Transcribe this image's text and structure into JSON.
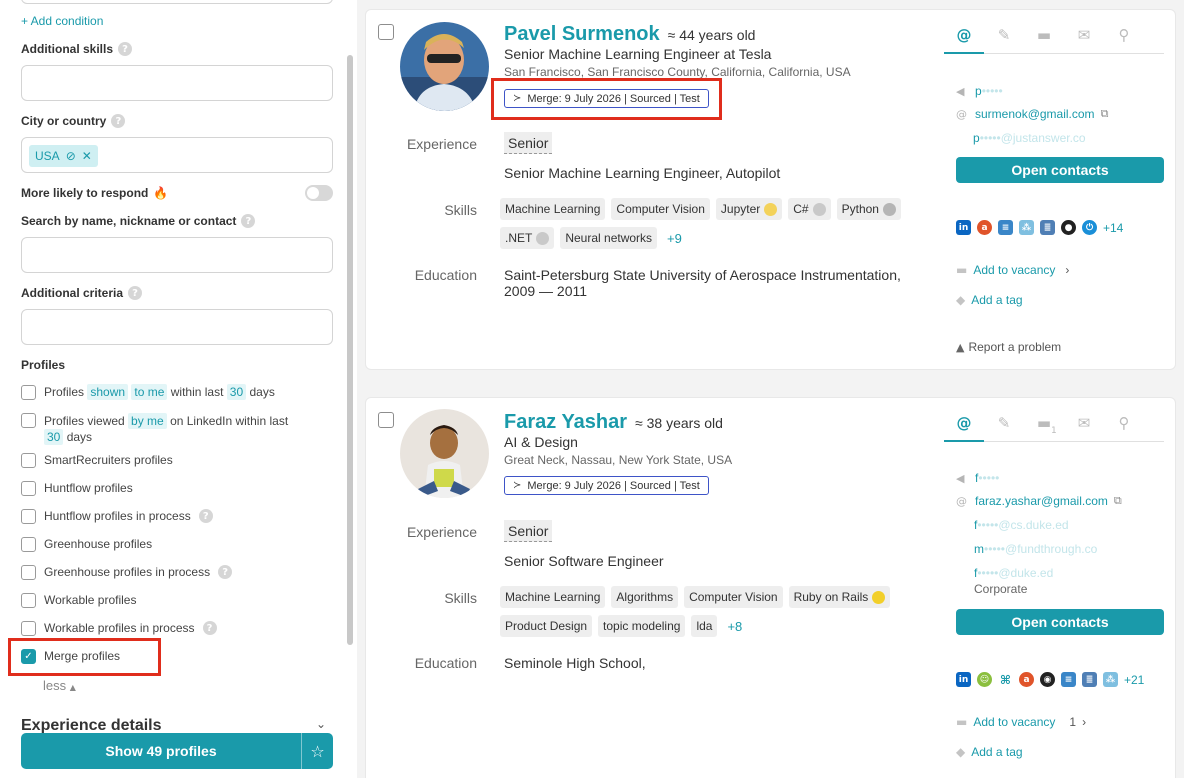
{
  "sidebar": {
    "add_condition": "+ Add condition",
    "additional_skills": {
      "label": "Additional skills",
      "value": ""
    },
    "city": {
      "label": "City or country",
      "chip": "USA"
    },
    "more_likely": {
      "label": "More likely to respond",
      "emoji": "🔥",
      "enabled": false
    },
    "search_name": {
      "label": "Search by name, nickname or contact",
      "value": ""
    },
    "additional_criteria": {
      "label": "Additional criteria",
      "value": ""
    },
    "profiles_heading": "Profiles",
    "profiles": [
      {
        "parts": [
          "Profiles",
          "shown",
          "to me",
          "within last",
          "30",
          "days"
        ]
      },
      {
        "parts": [
          "Profiles viewed",
          "by me",
          "on LinkedIn within last",
          "30",
          "days"
        ]
      },
      {
        "label": "SmartRecruiters profiles",
        "checked": false
      },
      {
        "label": "Huntflow profiles",
        "checked": false
      },
      {
        "label": "Huntflow profiles in process",
        "checked": false
      },
      {
        "label": "Greenhouse profiles",
        "checked": false
      },
      {
        "label": "Greenhouse profiles in process",
        "checked": false
      },
      {
        "label": "Workable profiles",
        "checked": false
      },
      {
        "label": "Workable profiles in process",
        "checked": false
      },
      {
        "label": "Merge profiles",
        "checked": true
      }
    ],
    "less": "less",
    "experience_details": "Experience details",
    "show_button": "Show 49 profiles"
  },
  "cards": [
    {
      "name": "Pavel Surmenok",
      "age": "≈ 44 years old",
      "title": "Senior Machine Learning Engineer at Tesla",
      "location": "San Francisco, San Francisco County, California, California, USA",
      "merge_badge": "Merge: 9 July 2026 | Sourced | Test",
      "labels": {
        "experience": "Experience",
        "skills": "Skills",
        "education": "Education"
      },
      "seniority": "Senior",
      "experience": "Senior Machine Learning Engineer, Autopilot",
      "skills": [
        "Machine Learning",
        "Computer Vision",
        "Jupyter",
        "C#",
        "Python",
        ".NET",
        "Neural networks"
      ],
      "skills_more": "+9",
      "education": "Saint-Petersburg State University of Aerospace Instrumentation, 2009 — 2011",
      "contacts": [
        {
          "icon": "telegram-icon",
          "prefix": "p",
          "mask": "•••••",
          "suffix": ""
        },
        {
          "icon": "at-icon",
          "text": "surmenok@gmail.com"
        },
        {
          "prefix": "p",
          "mask": "•••••",
          "suffix": "@justanswer.co"
        }
      ],
      "open_contacts": "Open contacts",
      "social_more": "+14",
      "add_vacancy": "Add to vacancy",
      "add_tag": "Add a tag",
      "report": "Report a problem"
    },
    {
      "name": "Faraz Yashar",
      "age": "≈ 38 years old",
      "title": "AI & Design",
      "location": "Great Neck, Nassau, New York State, USA",
      "merge_badge": "Merge: 9 July 2026 | Sourced | Test",
      "labels": {
        "experience": "Experience",
        "skills": "Skills",
        "education": "Education"
      },
      "seniority": "Senior",
      "experience": "Senior Software Engineer",
      "skills": [
        "Machine Learning",
        "Algorithms",
        "Computer Vision",
        "Ruby on Rails",
        "Product Design",
        "topic modeling",
        "lda"
      ],
      "skills_more": "+8",
      "education": "Seminole High School,",
      "folder_count": "1",
      "contacts": [
        {
          "icon": "telegram-icon",
          "prefix": "f",
          "mask": "•••••",
          "suffix": ""
        },
        {
          "icon": "at-icon",
          "text": "faraz.yashar@gmail.com"
        },
        {
          "prefix": "f",
          "mask": "•••••",
          "suffix": "@cs.duke.ed"
        },
        {
          "prefix": "m",
          "mask": "•••••",
          "suffix": "@fundthrough.co"
        },
        {
          "prefix": "f",
          "mask": "•••••",
          "suffix": "@duke.ed"
        }
      ],
      "contact_note": "Corporate",
      "open_contacts": "Open contacts",
      "social_more": "+21",
      "add_vacancy": "Add to vacancy",
      "vacancy_count": "1",
      "add_tag": "Add a tag"
    }
  ]
}
